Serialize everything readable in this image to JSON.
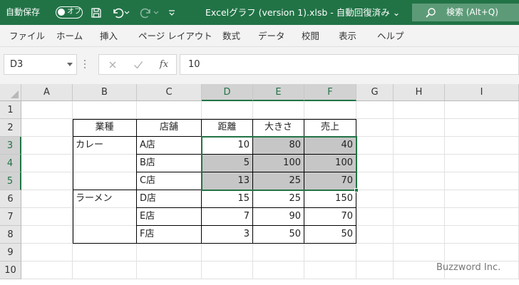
{
  "titlebar": {
    "autosave_label": "自動保存",
    "autosave_toggle": "オフ",
    "document_title": "Excelグラフ (version 1).xlsb  -  自動回復済み ⌄",
    "search_placeholder": "検索 (Alt+Q)",
    "icons": [
      "save-icon",
      "undo-icon",
      "redo-icon",
      "customize-qat-icon",
      "search-icon"
    ],
    "accent_color": "#217346"
  },
  "ribbon": {
    "tabs": [
      "ファイル",
      "ホーム",
      "挿入",
      "ページ レイアウト",
      "数式",
      "データ",
      "校閲",
      "表示",
      "ヘルプ"
    ]
  },
  "formula_bar": {
    "name_box": "D3",
    "formula": "10",
    "fx_label": "fx",
    "icons": [
      "cancel-icon",
      "enter-icon",
      "insert-function-icon"
    ]
  },
  "grid": {
    "columns": [
      "A",
      "B",
      "C",
      "D",
      "E",
      "F",
      "G",
      "H",
      "I"
    ],
    "selected_columns": [
      "D",
      "E",
      "F"
    ],
    "rows": [
      "1",
      "2",
      "3",
      "4",
      "5",
      "6",
      "7",
      "8",
      "9",
      "10"
    ],
    "selected_rows": [
      "3",
      "4",
      "5"
    ],
    "selection": "D3:F5",
    "active_cell": "D3",
    "selection_fill_color": "#c6c6c6",
    "table": {
      "header": {
        "B": "業種",
        "C": "店舗",
        "D": "距離",
        "E": "大きさ",
        "F": "売上"
      },
      "rows": [
        {
          "B": "カレー",
          "C": "A店",
          "D": "10",
          "E": "80",
          "F": "40"
        },
        {
          "B": "",
          "C": "B店",
          "D": "5",
          "E": "100",
          "F": "100"
        },
        {
          "B": "",
          "C": "C店",
          "D": "13",
          "E": "25",
          "F": "70"
        },
        {
          "B": "ラーメン",
          "C": "D店",
          "D": "15",
          "E": "25",
          "F": "150"
        },
        {
          "B": "",
          "C": "E店",
          "D": "7",
          "E": "90",
          "F": "70"
        },
        {
          "B": "",
          "C": "F店",
          "D": "3",
          "E": "50",
          "F": "50"
        }
      ]
    }
  },
  "watermark": "Buzzword Inc."
}
